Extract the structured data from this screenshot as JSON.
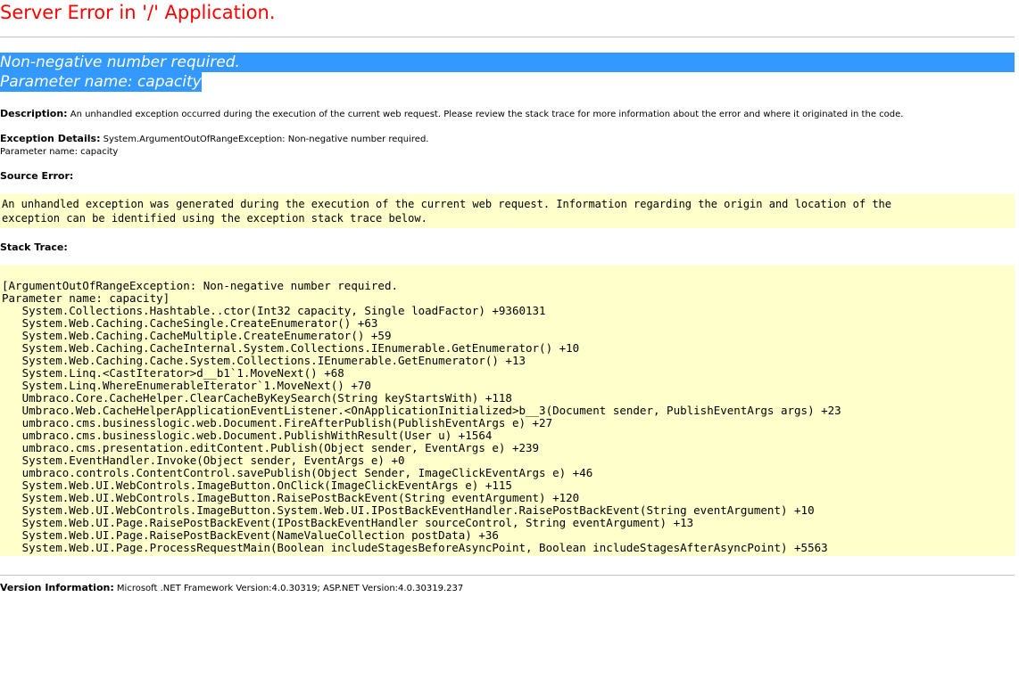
{
  "page": {
    "title": "Server Error in '/' Application.",
    "error_lines": [
      "Non-negative number required.",
      "Parameter name: capacity"
    ],
    "description": {
      "label": "Description:",
      "text": " An unhandled exception occurred during the execution of the current web request. Please review the stack trace for more information about the error and where it originated in the code."
    },
    "exception_details": {
      "label": "Exception Details:",
      "text": " System.ArgumentOutOfRangeException: Non-negative number required.",
      "param": "Parameter name: capacity"
    },
    "source_error": {
      "label": "Source Error:",
      "lines": [
        "An unhandled exception was generated during the execution of the current web request. Information regarding the origin and location of the",
        "exception can be identified using the exception stack trace below."
      ]
    },
    "stack_trace": {
      "label": "Stack Trace:",
      "lines": [
        "[ArgumentOutOfRangeException: Non-negative number required.",
        "Parameter name: capacity]",
        "   System.Collections.Hashtable..ctor(Int32 capacity, Single loadFactor) +9360131",
        "   System.Web.Caching.CacheSingle.CreateEnumerator() +63",
        "   System.Web.Caching.CacheMultiple.CreateEnumerator() +59",
        "   System.Web.Caching.CacheInternal.System.Collections.IEnumerable.GetEnumerator() +10",
        "   System.Web.Caching.Cache.System.Collections.IEnumerable.GetEnumerator() +13",
        "   System.Linq.<CastIterator>d__b1`1.MoveNext() +68",
        "   System.Linq.WhereEnumerableIterator`1.MoveNext() +70",
        "   Umbraco.Core.CacheHelper.ClearCacheByKeySearch(String keyStartsWith) +118",
        "   Umbraco.Web.CacheHelperApplicationEventListener.<OnApplicationInitialized>b__3(Document sender, PublishEventArgs args) +23",
        "   umbraco.cms.businesslogic.web.Document.FireAfterPublish(PublishEventArgs e) +27",
        "   umbraco.cms.businesslogic.web.Document.PublishWithResult(User u) +1564",
        "   umbraco.cms.presentation.editContent.Publish(Object sender, EventArgs e) +239",
        "   System.EventHandler.Invoke(Object sender, EventArgs e) +0",
        "   umbraco.controls.ContentControl.savePublish(Object Sender, ImageClickEventArgs e) +46",
        "   System.Web.UI.WebControls.ImageButton.OnClick(ImageClickEventArgs e) +115",
        "   System.Web.UI.WebControls.ImageButton.RaisePostBackEvent(String eventArgument) +120",
        "   System.Web.UI.WebControls.ImageButton.System.Web.UI.IPostBackEventHandler.RaisePostBackEvent(String eventArgument) +10",
        "   System.Web.UI.Page.RaisePostBackEvent(IPostBackEventHandler sourceControl, String eventArgument) +13",
        "   System.Web.UI.Page.RaisePostBackEvent(NameValueCollection postData) +36",
        "   System.Web.UI.Page.ProcessRequestMain(Boolean includeStagesBeforeAsyncPoint, Boolean includeStagesAfterAsyncPoint) +5563"
      ]
    },
    "version_info": {
      "label": "Version Information:",
      "text": " Microsoft .NET Framework Version:4.0.30319; ASP.NET Version:4.0.30319.237"
    },
    "colors": {
      "title": "#ff0000",
      "highlight": "#3399ff",
      "code_background": "#ffffcc",
      "rule": "#c0c0c0"
    }
  }
}
